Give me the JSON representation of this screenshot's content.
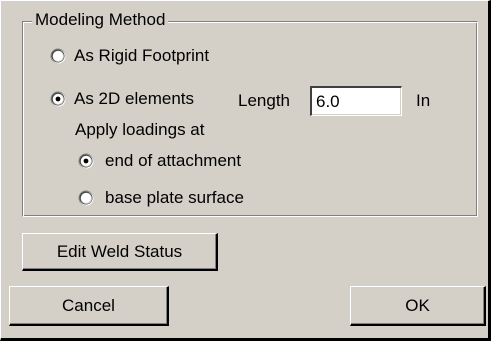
{
  "group": {
    "title": "Modeling Method",
    "options": [
      {
        "label": "As Rigid Footprint",
        "selected": false
      },
      {
        "label": "As 2D elements",
        "selected": true
      }
    ],
    "length_label": "Length",
    "length_value": "6.0",
    "length_unit": "In",
    "apply_label": "Apply loadings at",
    "apply_options": [
      {
        "label": "end of attachment",
        "selected": true
      },
      {
        "label": "base plate surface",
        "selected": false
      }
    ]
  },
  "buttons": {
    "edit_weld": "Edit Weld Status",
    "cancel": "Cancel",
    "ok": "OK"
  },
  "colors": {
    "face": "#d4d0c8",
    "shadow": "#808080",
    "highlight": "#ffffff"
  }
}
